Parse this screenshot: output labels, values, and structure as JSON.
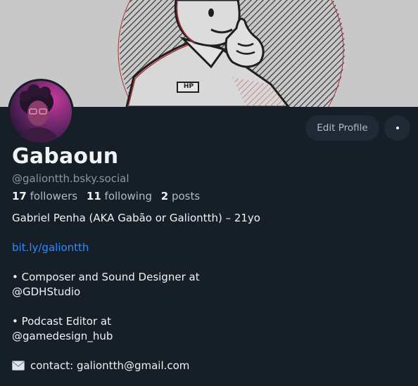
{
  "profile": {
    "display_name": "Gabaoun",
    "handle": "@galiontth.bsky.social",
    "stats": {
      "followers_count": "17",
      "followers_label": "followers",
      "following_count": "11",
      "following_label": "following",
      "posts_count": "2",
      "posts_label": "posts"
    },
    "bio": {
      "line1": "Gabriel Penha (AKA Gabão or Galiontth) – 21yo",
      "link": "bit.ly/galiontth",
      "line3a": "• Composer and Sound Designer at",
      "line3b": "@GDHStudio",
      "line4a": "• Podcast Editor at",
      "line4b": "@gamedesign_hub",
      "contact": "contact: galiontth@gmail.com"
    }
  },
  "actions": {
    "edit_label": "Edit Profile"
  },
  "banner": {
    "badge_text": "HP"
  },
  "icons": {
    "more": "more-horizontal-icon",
    "mail": "envelope-icon"
  },
  "colors": {
    "background": "#161e27",
    "accent_link": "#2d8cff",
    "button_bg": "#1f2a36"
  }
}
